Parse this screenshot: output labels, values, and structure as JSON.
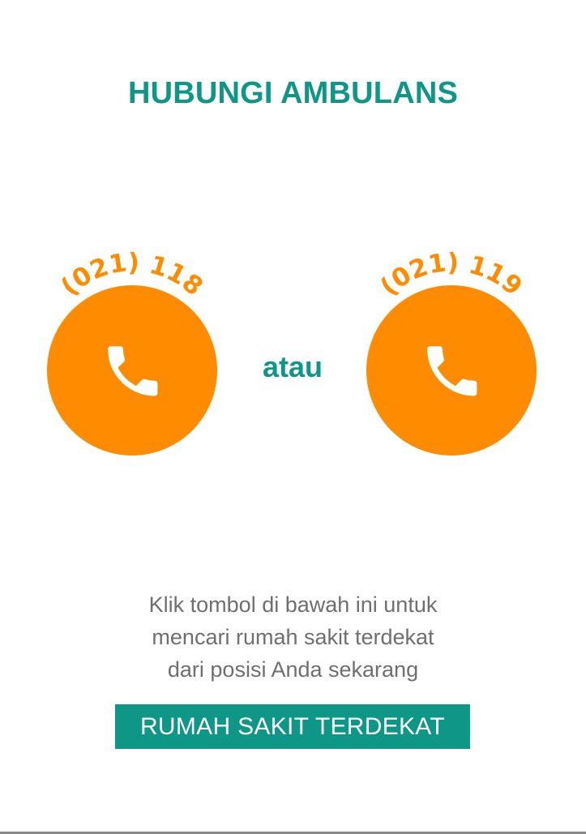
{
  "header": {
    "title": "HUBUNGI AMBULANS"
  },
  "calls": [
    {
      "number": "(021) 118",
      "icon": "phone-icon"
    },
    {
      "number": "(021) 119",
      "icon": "phone-icon"
    }
  ],
  "separator": "atau",
  "info": {
    "lines": [
      "Klik tombol di bawah ini untuk",
      "mencari rumah sakit terdekat",
      "dari posisi Anda sekarang"
    ]
  },
  "cta": {
    "label": "RUMAH SAKIT TERDEKAT"
  },
  "colors": {
    "accent": "#0e9686",
    "orange": "#ff8c00",
    "text_gray": "#6f6f6f"
  }
}
